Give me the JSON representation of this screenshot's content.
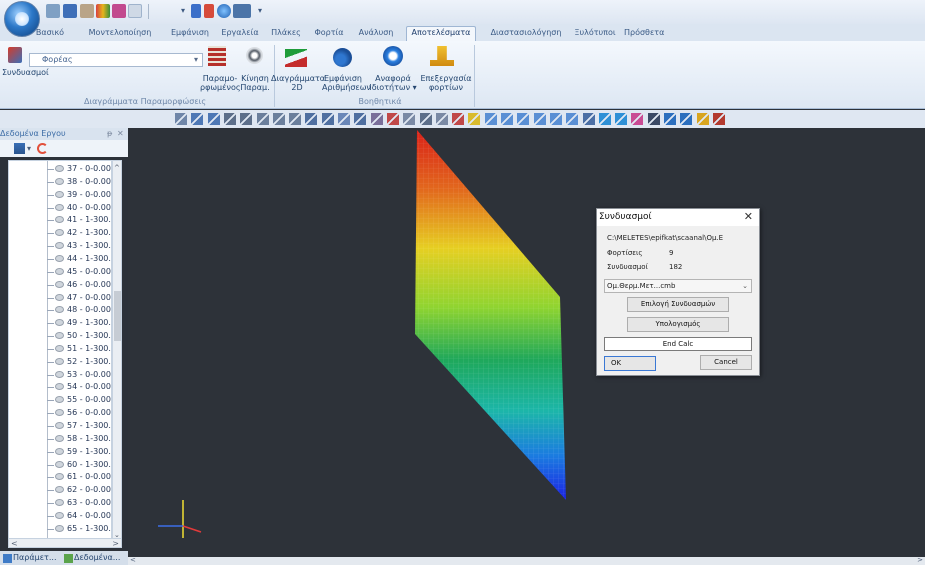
{
  "ribbon_tabs": [
    "Βασικό",
    "Μοντελοποίηση",
    "Εμφάνιση",
    "Εργαλεία",
    "Πλάκες",
    "Φορτία",
    "Ανάλυση",
    "Αποτελέσματα",
    "Διαστασιολόγηση",
    "Ξυλότυποι",
    "Πρόσθετα"
  ],
  "active_tab": "Αποτελέσματα",
  "ribbon": {
    "combinations_label": "Συνδυασμοί",
    "element_select_value": "Φορέας",
    "deformed_label_line1": "Παραμο-",
    "deformed_label_line2": "ρφωμένος",
    "motion_label_line1": "Κίνηση",
    "motion_label_line2": "Παραμ.",
    "group1_caption": "Διαγράμματα Παραμορφώσεις",
    "diagrams_label_line1": "Διαγράμματα",
    "diagrams_label_line2": "2D",
    "display_label_line1": "Εμφάνιση",
    "display_label_line2": "Αριθμήσεων",
    "report_label_line1": "Αναφορά",
    "report_label_line2": "Ιδιοτήτων ▾",
    "process_label_line1": "Επεξεργασία",
    "process_label_line2": "φορτίων",
    "group2_caption": "Βοηθητικά"
  },
  "side_panel": {
    "title": "Δεδομένα Εργου",
    "pin": "ᵽ",
    "close": "✕",
    "tree_items": [
      "37 - 0-0.00",
      "38 - 0-0.00",
      "39 - 0-0.00",
      "40 - 0-0.00",
      "41 - 1-300.",
      "42 - 1-300.",
      "43 - 1-300.",
      "44 - 1-300.",
      "45 - 0-0.00",
      "46 - 0-0.00",
      "47 - 0-0.00",
      "48 - 0-0.00",
      "49 - 1-300.",
      "50 - 1-300.",
      "51 - 1-300.",
      "52 - 1-300.",
      "53 - 0-0.00",
      "54 - 0-0.00",
      "55 - 0-0.00",
      "56 - 0-0.00",
      "57 - 1-300.",
      "58 - 1-300.",
      "59 - 1-300.",
      "60 - 1-300.",
      "61 - 0-0.00",
      "62 - 0-0.00",
      "63 - 0-0.00",
      "64 - 0-0.00",
      "65 - 1-300."
    ],
    "bottom_tabs": [
      "Παράμετ...",
      "Δεδομένα..."
    ]
  },
  "dialog": {
    "title": "Συνδυασμοί",
    "close": "✕",
    "path": "C:\\MELETES\\epifkat\\scaanal\\Ομ.Ε",
    "loads_label": "Φορτίσεις",
    "loads_value": "9",
    "combos_label": "Συνδυασμοί",
    "combos_value": "182",
    "combo_select": "Ομ.Θερμ.Μετ...cmb",
    "select_combos_button": "Επιλογή Συνδυασμών",
    "calc_button": "Υπολογισμός",
    "end_calc": "End Calc",
    "ok_button": "OK",
    "cancel_button": "Cancel"
  },
  "colors": {
    "viewport_bg": "#2d3239",
    "ribbon_bg": "#e7eef8",
    "accent": "#3c6ca6",
    "contour_high": "#e0201b",
    "contour_mid": "#e6d321",
    "contour_low": "#1c2fe6"
  }
}
